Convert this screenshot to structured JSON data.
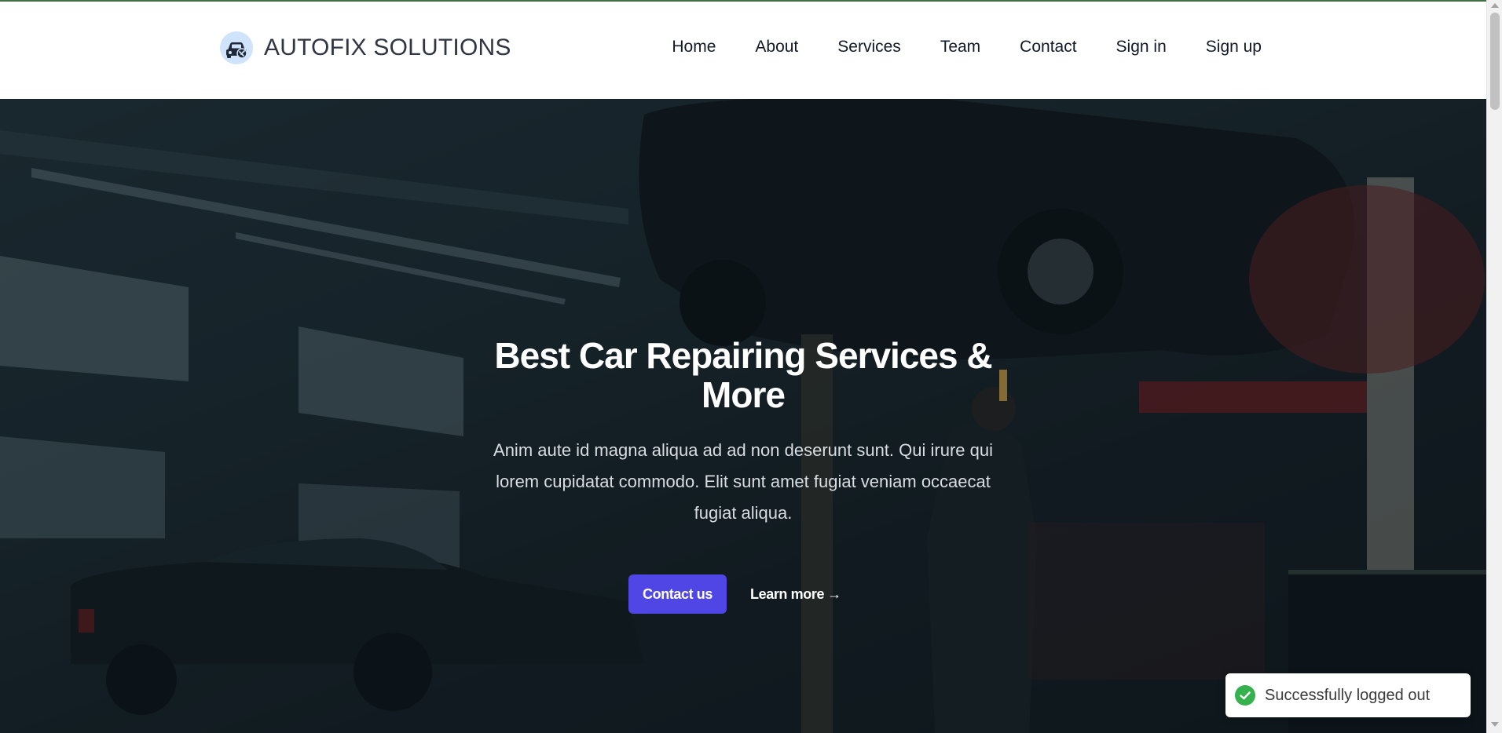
{
  "brand": {
    "name": "AUTOFIX SOLUTIONS",
    "logo_icon": "car-repair-icon"
  },
  "nav": {
    "items": [
      {
        "label": "Home"
      },
      {
        "label": "About"
      },
      {
        "label": "Services"
      },
      {
        "label": "Team"
      },
      {
        "label": "Contact"
      },
      {
        "label": "Sign in"
      },
      {
        "label": "Sign up"
      }
    ]
  },
  "hero": {
    "title": "Best Car Repairing Services & More",
    "description": "Anim aute id magna aliqua ad ad non deserunt sunt. Qui irure qui lorem cupidatat commodo. Elit sunt amet fugiat veniam occaecat fugiat aliqua.",
    "primary_button": "Contact us",
    "secondary_link": "Learn more",
    "secondary_arrow": "→",
    "background_image": "car-garage-mechanic-photo"
  },
  "toast": {
    "message": "Successfully logged out",
    "icon": "check-circle-icon",
    "status_color": "#35b24d"
  },
  "colors": {
    "accent": "#4f46e5",
    "brand_text": "#2f3542"
  }
}
